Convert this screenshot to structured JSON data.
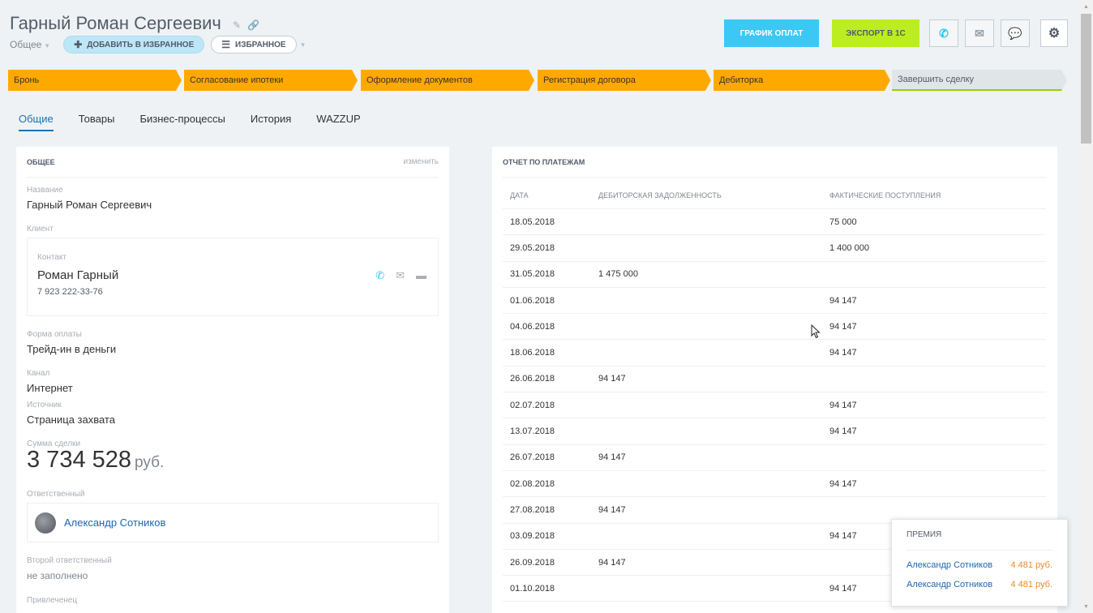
{
  "header": {
    "title": "Гарный Роман Сергеевич",
    "category": "Общее",
    "add_favorite": "ДОБАВИТЬ В ИЗБРАННОЕ",
    "favorites": "ИЗБРАННОЕ",
    "payment_schedule": "ГРАФИК ОПЛАТ",
    "export_1c": "ЭКСПОРТ В 1С"
  },
  "stages": [
    "Бронь",
    "Согласование ипотеки",
    "Оформление документов",
    "Регистрация договора",
    "Дебиторка",
    "Завершить сделку"
  ],
  "tabs": [
    "Общие",
    "Товары",
    "Бизнес-процессы",
    "История",
    "WAZZUP"
  ],
  "general": {
    "heading": "ОБЩЕЕ",
    "edit": "изменить",
    "name_label": "Название",
    "name_value": "Гарный Роман Сергеевич",
    "client_label": "Клиент",
    "contact_label": "Контакт",
    "contact_name": "Роман Гарный",
    "contact_phone": "7 923 222-33-76",
    "payment_form_label": "Форма оплаты",
    "payment_form_value": "Трейд-ин в деньги",
    "channel_label": "Канал",
    "channel_value": "Интернет",
    "source_label": "Источник",
    "source_value": "Страница захвата",
    "amount_label": "Сумма сделки",
    "amount_value": "3 734 528",
    "amount_currency": "руб.",
    "responsible_label": "Ответственный",
    "responsible_value": "Александр Сотников",
    "second_responsible_label": "Второй ответственный",
    "second_responsible_value": "не заполнено",
    "attracted_label": "Привлеченец"
  },
  "report": {
    "heading": "ОТЧЕТ ПО ПЛАТЕЖАМ",
    "columns": [
      "ДАТА",
      "ДЕБИТОРСКАЯ ЗАДОЛЖЕННОСТЬ",
      "ФАКТИЧЕСКИЕ ПОСТУПЛЕНИЯ"
    ],
    "rows": [
      [
        "18.05.2018",
        "",
        "75 000"
      ],
      [
        "29.05.2018",
        "",
        "1 400 000"
      ],
      [
        "31.05.2018",
        "1 475 000",
        ""
      ],
      [
        "01.06.2018",
        "",
        "94 147"
      ],
      [
        "04.06.2018",
        "",
        "94 147"
      ],
      [
        "18.06.2018",
        "",
        "94 147"
      ],
      [
        "26.06.2018",
        "94 147",
        ""
      ],
      [
        "02.07.2018",
        "",
        "94 147"
      ],
      [
        "13.07.2018",
        "",
        "94 147"
      ],
      [
        "26.07.2018",
        "94 147",
        ""
      ],
      [
        "02.08.2018",
        "",
        "94 147"
      ],
      [
        "27.08.2018",
        "94 147",
        ""
      ],
      [
        "03.09.2018",
        "",
        "94 147"
      ],
      [
        "26.09.2018",
        "94 147",
        ""
      ],
      [
        "01.10.2018",
        "",
        "94 147"
      ]
    ]
  },
  "bonus_popup": {
    "title": "ПРЕМИЯ",
    "rows": [
      {
        "name": "Александр Сотников",
        "amount": "4 481 руб."
      },
      {
        "name": "Александр Сотников",
        "amount": "4 481 руб."
      }
    ]
  },
  "colors": {
    "stage_active": "#ffa900",
    "schedule_button": "#3bc8f5",
    "export_button": "#bbed21",
    "link": "#2067b0",
    "bonus_amount": "#e98b2d"
  }
}
